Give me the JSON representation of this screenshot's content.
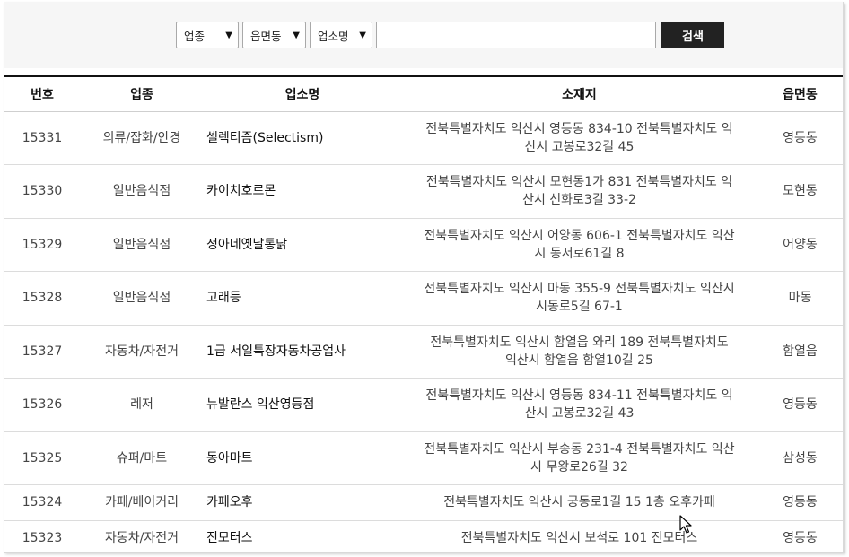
{
  "search": {
    "filters": [
      {
        "label": "업종"
      },
      {
        "label": "읍면동"
      },
      {
        "label": "업소명"
      }
    ],
    "input_value": "",
    "button_label": "검색"
  },
  "table": {
    "headers": [
      "번호",
      "업종",
      "업소명",
      "소재지",
      "읍면동"
    ],
    "rows": [
      {
        "no": "15331",
        "category": "의류/잡화/안경",
        "name": "셀렉티즘(Selectism)",
        "address": "전북특별자치도 익산시 영등동 834-10 전북특별자치도 익산시 고봉로32길 45",
        "dong": "영등동"
      },
      {
        "no": "15330",
        "category": "일반음식점",
        "name": "카이치호르몬",
        "address": "전북특별자치도 익산시 모현동1가 831 전북특별자치도 익산시 선화로3길 33-2",
        "dong": "모현동"
      },
      {
        "no": "15329",
        "category": "일반음식점",
        "name": "정아네옛날통닭",
        "address": "전북특별자치도 익산시 어양동 606-1 전북특별자치도 익산시 동서로61길 8",
        "dong": "어양동"
      },
      {
        "no": "15328",
        "category": "일반음식점",
        "name": "고래등",
        "address": "전북특별자치도 익산시 마동 355-9 전북특별자치도 익산시 시동로5길 67-1",
        "dong": "마동"
      },
      {
        "no": "15327",
        "category": "자동차/자전거",
        "name": "1급 서일특장자동차공업사",
        "address": "전북특별자치도 익산시 함열읍 와리 189 전북특별자치도 익산시 함열읍 함열10길 25",
        "dong": "함열읍"
      },
      {
        "no": "15326",
        "category": "레저",
        "name": "뉴발란스 익산영등점",
        "address": "전북특별자치도 익산시 영등동 834-11 전북특별자치도 익산시 고봉로32길 43",
        "dong": "영등동"
      },
      {
        "no": "15325",
        "category": "슈퍼/마트",
        "name": "동아마트",
        "address": "전북특별자치도 익산시 부송동 231-4 전북특별자치도 익산시 무왕로26길 32",
        "dong": "삼성동"
      },
      {
        "no": "15324",
        "category": "카페/베이커리",
        "name": "카페오후",
        "address": "전북특별자치도 익산시 궁동로1길 15 1층 오후카페",
        "dong": "영등동"
      },
      {
        "no": "15323",
        "category": "자동차/자전거",
        "name": "진모터스",
        "address": "전북특별자치도 익산시 보석로 101 진모터스",
        "dong": "영등동"
      }
    ]
  }
}
